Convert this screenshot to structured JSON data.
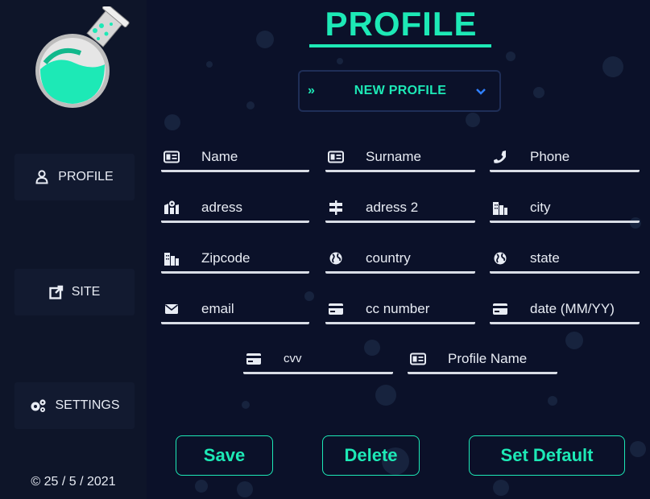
{
  "sidebar": {
    "items": [
      {
        "label": "PROFILE",
        "icon": "user-icon"
      },
      {
        "label": "SITE",
        "icon": "external-link-icon"
      },
      {
        "label": "SETTINGS",
        "icon": "cogs-icon"
      }
    ],
    "copyright": "© 25 / 5 / 2021"
  },
  "header": {
    "title": "PROFILE"
  },
  "profile_select": {
    "selected": "NEW PROFILE",
    "prefix_icon": "chevrons-right-icon",
    "caret_icon": "chevron-down-icon"
  },
  "form": {
    "name": "Name",
    "surname": "Surname",
    "phone": "Phone",
    "address1": "adress",
    "address2": "adress 2",
    "city": "city",
    "zipcode": "Zipcode",
    "country": "country",
    "state": "state",
    "email": "email",
    "cc_number": "cc number",
    "expiry": "date (MM/YY)",
    "cvv": "cvv",
    "profile_name": "Profile Name"
  },
  "actions": {
    "save": "Save",
    "delete": "Delete",
    "set_default": "Set Default"
  },
  "colors": {
    "accent": "#1de9b6",
    "background": "#0b1129",
    "sidebar": "#0e1529",
    "field_line": "#d9dde6"
  }
}
